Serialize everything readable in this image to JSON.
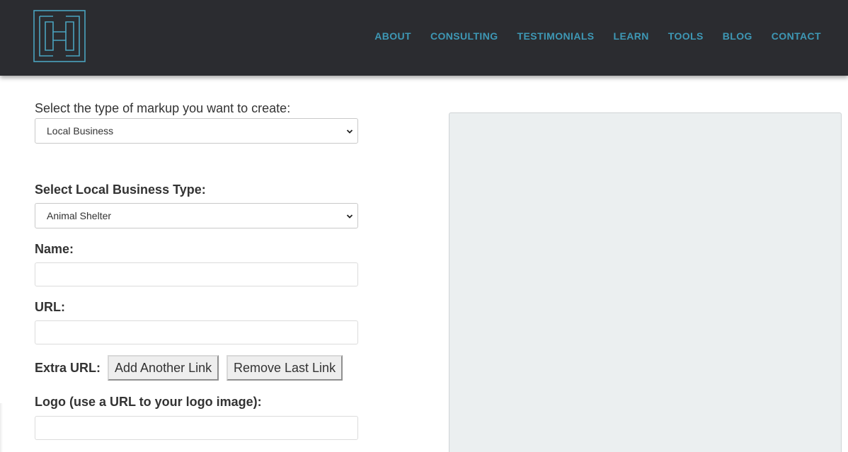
{
  "header": {
    "logo_icon": "h-maze-logo-icon",
    "accent_color": "#3e98b5",
    "background_color": "#2b2c30",
    "nav": [
      {
        "label": "ABOUT"
      },
      {
        "label": "CONSULTING"
      },
      {
        "label": "TESTIMONIALS"
      },
      {
        "label": "LEARN"
      },
      {
        "label": "TOOLS"
      },
      {
        "label": "BLOG"
      },
      {
        "label": "CONTACT"
      }
    ]
  },
  "form": {
    "markup_type_label": "Select the type of markup you want to create:",
    "markup_type_value": "Local Business",
    "business_type_label": "Select Local Business Type:",
    "business_type_value": "Animal Shelter",
    "name_label": "Name:",
    "name_value": "",
    "url_label": "URL:",
    "url_value": "",
    "extra_url_label": "Extra URL:",
    "add_link_label": "Add Another Link",
    "remove_link_label": "Remove Last Link",
    "logo_label": "Logo (use a URL to your logo image):",
    "logo_value": ""
  },
  "preview": {
    "background_color": "#ebeff0"
  }
}
